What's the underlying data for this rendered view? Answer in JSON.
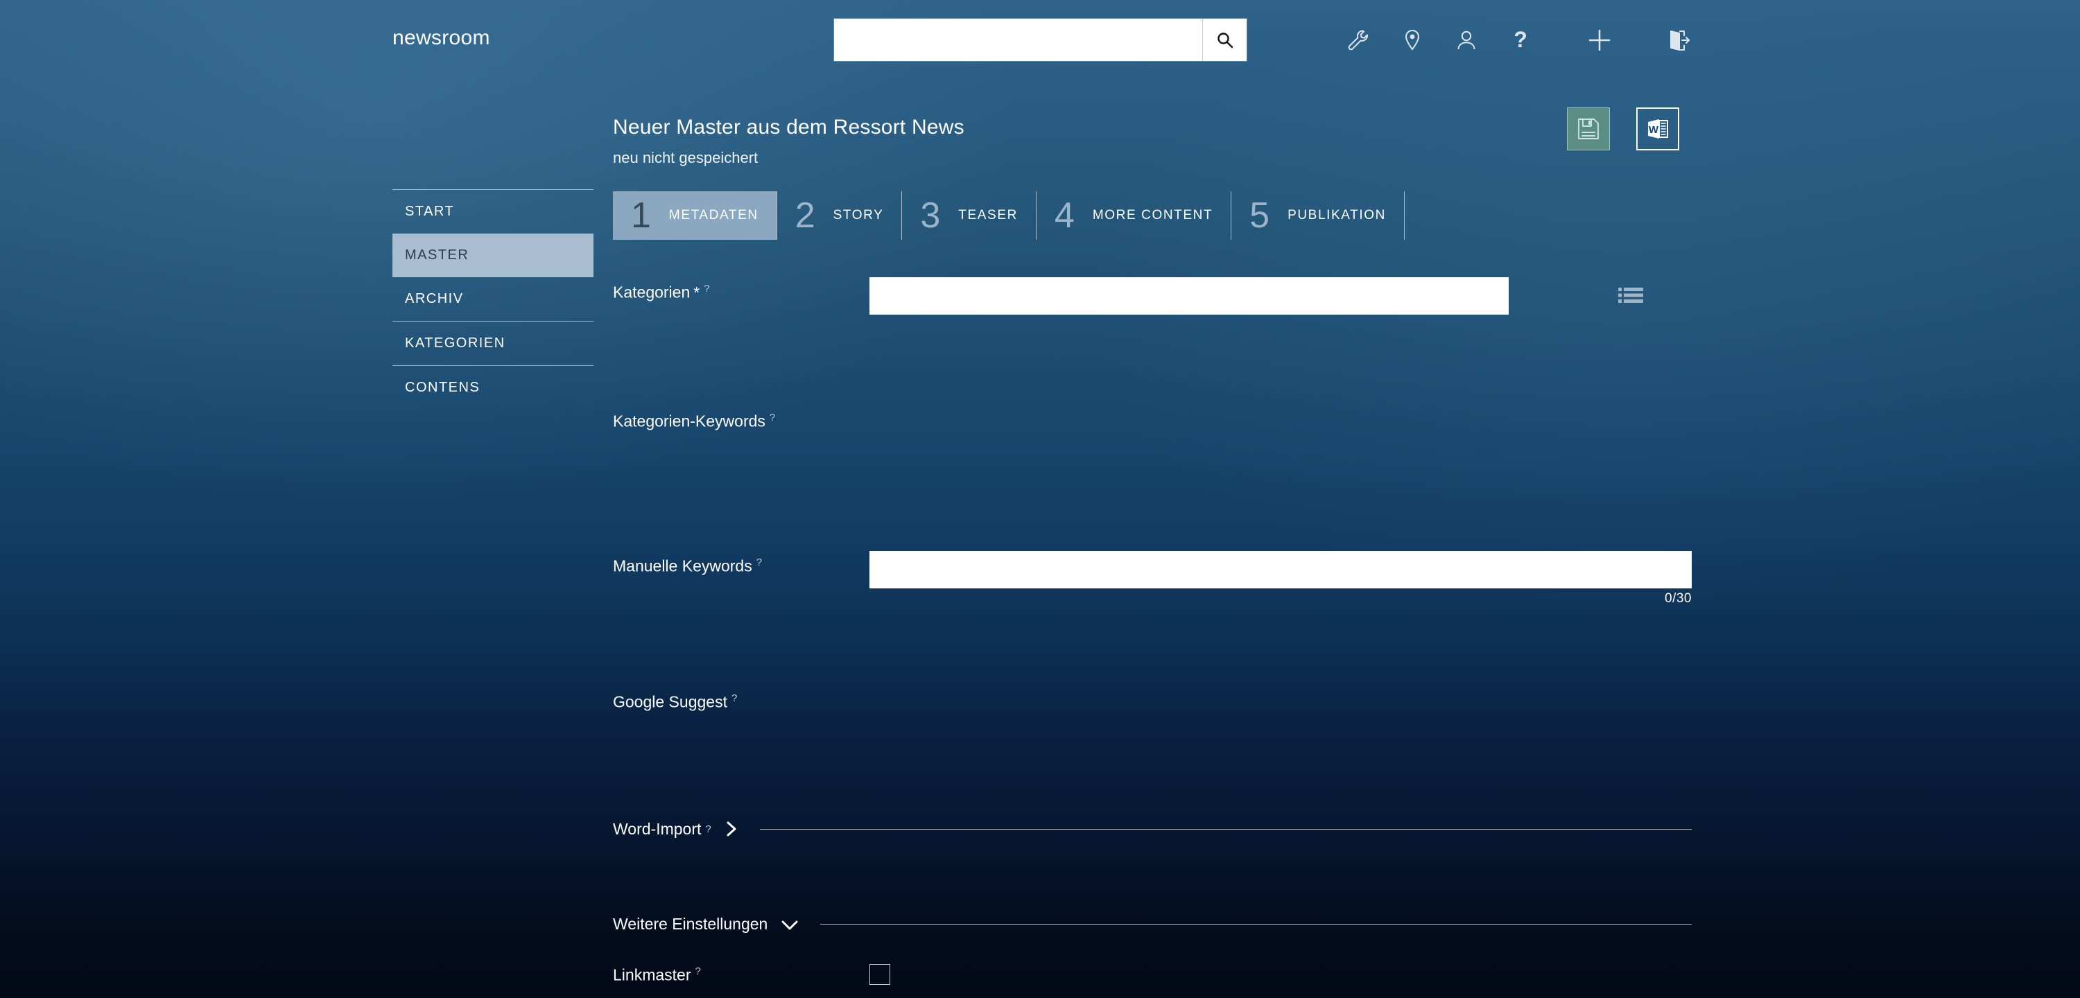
{
  "header": {
    "brand": "newsroom",
    "search": {
      "value": "",
      "placeholder": ""
    },
    "icons": [
      {
        "name": "wrench-icon",
        "title": "Werkzeuge"
      },
      {
        "name": "location-pin-icon",
        "title": "Standort"
      },
      {
        "name": "user-icon",
        "title": "Benutzer"
      },
      {
        "name": "help-question-icon",
        "title": "Hilfe"
      },
      {
        "name": "plus-icon",
        "title": "Neu"
      },
      {
        "name": "logout-icon",
        "title": "Abmelden"
      }
    ]
  },
  "sidebar": {
    "items": [
      {
        "label": "START",
        "active": false
      },
      {
        "label": "MASTER",
        "active": true
      },
      {
        "label": "ARCHIV",
        "active": false
      },
      {
        "label": "KATEGORIEN",
        "active": false
      },
      {
        "label": "CONTENS",
        "active": false
      }
    ]
  },
  "document": {
    "title": "Neuer Master aus dem Ressort News",
    "status": "neu nicht gespeichert",
    "actions": {
      "save_title": "Speichern",
      "word_title": "Word-Export",
      "word_letter": "W"
    }
  },
  "stepper": {
    "steps": [
      {
        "num": "1",
        "label": "METADATEN",
        "active": true
      },
      {
        "num": "2",
        "label": "STORY",
        "active": false
      },
      {
        "num": "3",
        "label": "TEASER",
        "active": false
      },
      {
        "num": "4",
        "label": "MORE CONTENT",
        "active": false
      },
      {
        "num": "5",
        "label": "PUBLIKATION",
        "active": false
      }
    ]
  },
  "form": {
    "help_glyph": "?",
    "required_glyph": "*",
    "kategorien": {
      "label": "Kategorien",
      "value": "",
      "placeholder": "",
      "list_button_title": "Kategorien auswählen"
    },
    "kategorien_keywords": {
      "label": "Kategorien-Keywords"
    },
    "manuelle_keywords": {
      "label": "Manuelle Keywords",
      "value": "",
      "placeholder": "",
      "counter": "0/30"
    },
    "google_suggest": {
      "label": "Google Suggest"
    },
    "word_import": {
      "label": "Word-Import",
      "expanded": false,
      "chevron": "chevron-right-icon"
    },
    "weitere_einstellungen": {
      "label": "Weitere Einstellungen",
      "expanded": true,
      "chevron": "chevron-down-icon"
    },
    "linkmaster": {
      "label": "Linkmaster",
      "checked": false
    }
  },
  "colors": {
    "accent_active": "#8ca8c0",
    "sidebar_active": "#a9bdd0",
    "save_green": "#5b8f86",
    "bg_top": "#2e6288",
    "bg_bottom": "#030916"
  }
}
